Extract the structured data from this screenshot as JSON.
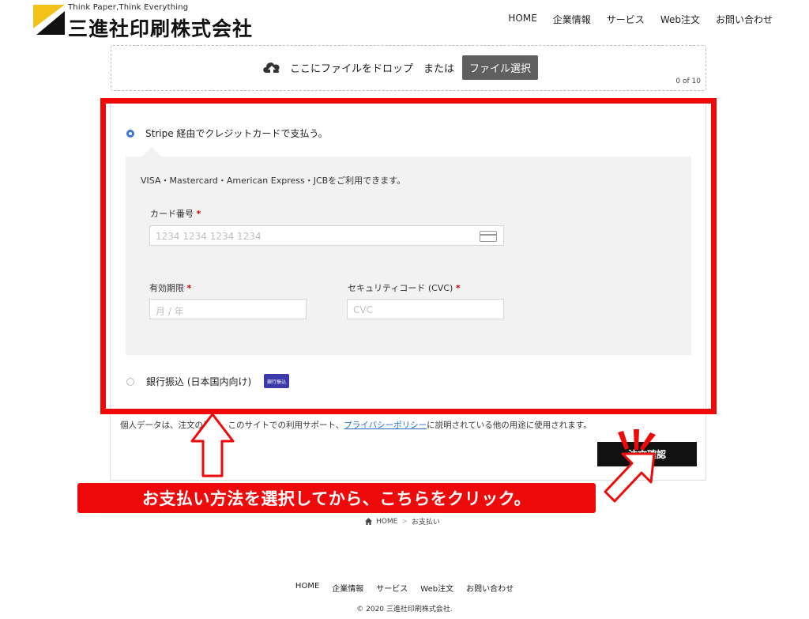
{
  "header": {
    "tagline": "Think Paper,Think Everything",
    "company_name": "三進社印刷株式会社",
    "nav": [
      "HOME",
      "企業情報",
      "サービス",
      "Web注文",
      "お問い合わせ"
    ]
  },
  "dropzone": {
    "text": "ここにファイルをドロップ　または",
    "button": "ファイル選択",
    "count": "0 of 10"
  },
  "payment": {
    "stripe_option": "Stripe 経由でクレジットカードで支払う。",
    "stripe_selected": true,
    "description": "VISA・Mastercard・American Express・JCBをご利用できます。",
    "card_number_label": "カード番号",
    "card_number_placeholder": "1234 1234 1234 1234",
    "expiry_label": "有効期限",
    "expiry_placeholder": "月 / 年",
    "cvc_label": "セキュリティコード (CVC)",
    "cvc_placeholder": "CVC",
    "required_mark": "*",
    "bank_option": "銀行振込 (日本国内向け)",
    "bank_badge": "銀行振込"
  },
  "privacy": {
    "text_before": "個人データは、注文の処理、このサイトでの利用サポート、",
    "link": "プライバシーポリシー",
    "text_after": "に説明されている他の用途に使用されます。"
  },
  "confirm_button": "注文確認",
  "annotation": {
    "callout": "お支払い方法を選択してから、こちらをクリック。",
    "highlight_color": "#ee0a0a"
  },
  "breadcrumb": {
    "home": "HOME",
    "separator": ">",
    "current": "お支払い"
  },
  "footer": {
    "nav": [
      "HOME",
      "企業情報",
      "サービス",
      "Web注文",
      "お問い合わせ"
    ],
    "copyright": "© 2020 三進社印刷株式会社."
  }
}
